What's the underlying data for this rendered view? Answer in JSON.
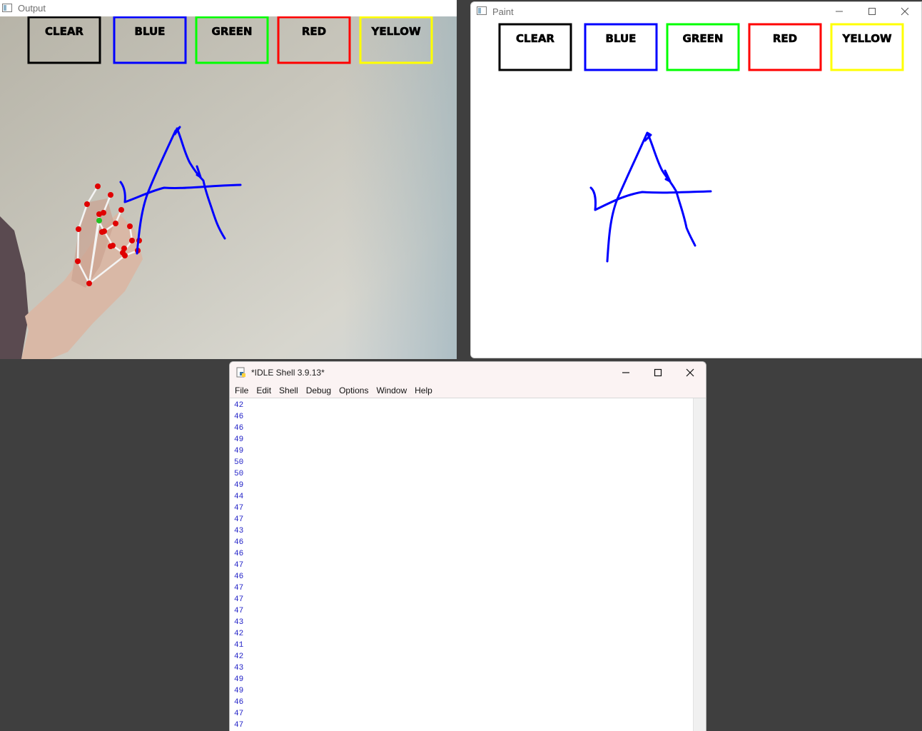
{
  "output_window": {
    "title": "Output",
    "buttons": [
      {
        "label": "CLEAR",
        "color": "#000000"
      },
      {
        "label": "BLUE",
        "color": "#0000ff"
      },
      {
        "label": "GREEN",
        "color": "#00ff00"
      },
      {
        "label": "RED",
        "color": "#ff0000"
      },
      {
        "label": "YELLOW",
        "color": "#ffff00"
      }
    ],
    "stroke_color": "#0000ff"
  },
  "paint_window": {
    "title": "Paint",
    "controls": [
      "minimize-icon",
      "maximize-icon",
      "close-icon"
    ],
    "buttons": [
      {
        "label": "CLEAR",
        "color": "#000000"
      },
      {
        "label": "BLUE",
        "color": "#0000ff"
      },
      {
        "label": "GREEN",
        "color": "#00ff00"
      },
      {
        "label": "RED",
        "color": "#ff0000"
      },
      {
        "label": "YELLOW",
        "color": "#ffff00"
      }
    ],
    "stroke_color": "#0000ff"
  },
  "idle_window": {
    "title": "*IDLE Shell 3.9.13*",
    "menu": [
      "File",
      "Edit",
      "Shell",
      "Debug",
      "Options",
      "Window",
      "Help"
    ],
    "output_lines": [
      "42",
      "46",
      "46",
      "49",
      "49",
      "50",
      "50",
      "49",
      "44",
      "47",
      "47",
      "43",
      "46",
      "46",
      "47",
      "46",
      "47",
      "47",
      "47",
      "43",
      "42",
      "41",
      "42",
      "43",
      "49",
      "49",
      "46",
      "47",
      "47"
    ],
    "text_color": "#2424c8"
  }
}
